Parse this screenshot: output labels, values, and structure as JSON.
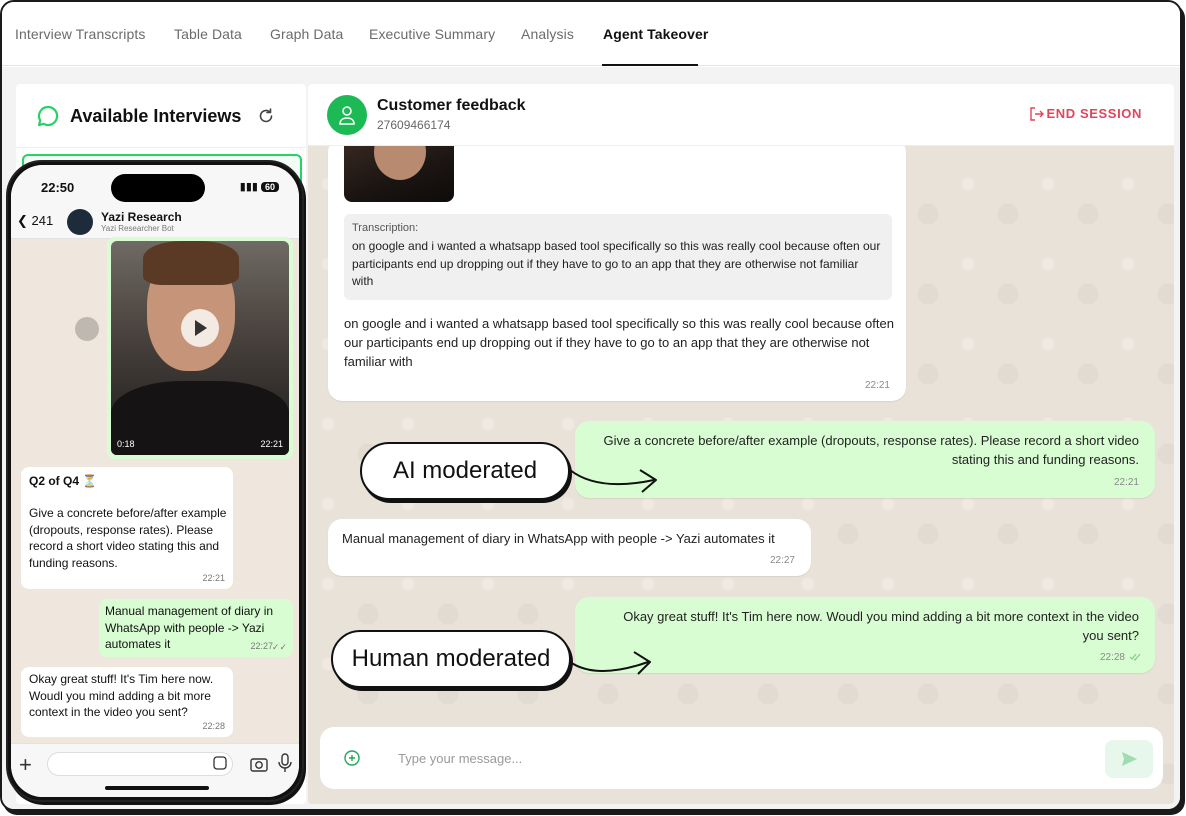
{
  "tabs": [
    {
      "label": "Interview Transcripts"
    },
    {
      "label": "Table Data"
    },
    {
      "label": "Graph Data"
    },
    {
      "label": "Executive Summary"
    },
    {
      "label": "Analysis"
    },
    {
      "label": "Agent Takeover",
      "active": true
    }
  ],
  "sidebar": {
    "title": "Available Interviews",
    "icons": {
      "title": "chat-bubble-icon",
      "refresh": "refresh-icon"
    }
  },
  "chat": {
    "name": "Customer feedback",
    "phone": "27609466174",
    "end_session": "END SESSION",
    "messages": [
      {
        "direction": "in",
        "transcription_label": "Transcription:",
        "transcription": "on google and i wanted a whatsapp based tool specifically so this was really cool because often our participants end up dropping out if they have to go to an app that they are otherwise not familiar with",
        "text": "on google and i wanted a whatsapp based tool specifically so this was really cool because often our participants end up dropping out if they have to go to an app that they are otherwise not familiar with",
        "time": "22:21"
      },
      {
        "direction": "out",
        "text": "Give a concrete before/after example (dropouts, response rates). Please record a short video stating this and funding reasons.",
        "time": "22:21"
      },
      {
        "direction": "in",
        "text": "Manual management of diary in WhatsApp with people -> Yazi automates it",
        "time": "22:27"
      },
      {
        "direction": "out",
        "text": "Okay great stuff! It's Tim here now. Woudl you mind adding a bit more context in the video you sent?",
        "time": "22:28"
      }
    ],
    "input_placeholder": "Type your message..."
  },
  "callouts": {
    "ai": "AI moderated",
    "human": "Human moderated"
  },
  "phone": {
    "status_time": "22:50",
    "battery": "60",
    "back_count": "241",
    "contact_name": "Yazi Research",
    "contact_sub": "Yazi Researcher Bot",
    "video_duration": "0:18",
    "video_time": "22:21",
    "messages": [
      {
        "direction": "in",
        "title": "Q2 of Q4 ⏳",
        "text": "Give a concrete before/after example (dropouts, response rates). Please record a short video stating this and funding reasons.",
        "time": "22:21"
      },
      {
        "direction": "out",
        "text": "Manual management of diary in WhatsApp with people -> Yazi automates it",
        "time": "22:27"
      },
      {
        "direction": "in",
        "text": "Okay great stuff! It's Tim here now. Woudl you mind adding a bit more context in the video you sent?",
        "time": "22:28"
      }
    ]
  },
  "colors": {
    "accent_green": "#25d366",
    "end_session_red": "#e0455a",
    "outgoing_bubble": "#d9fdd3"
  }
}
